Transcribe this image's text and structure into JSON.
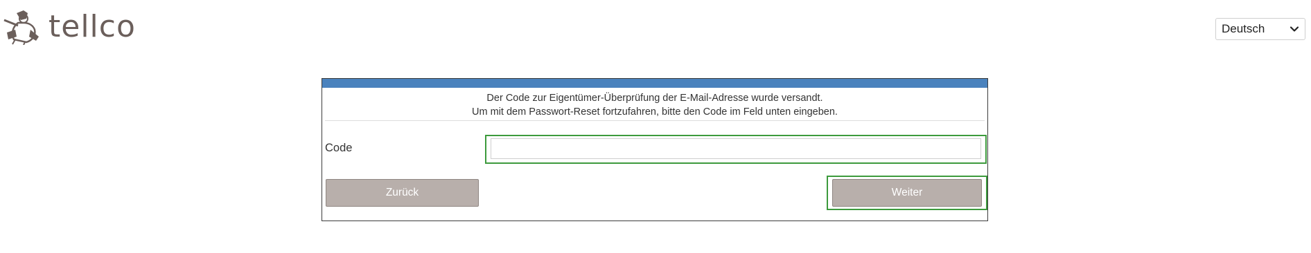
{
  "header": {
    "logo_text": "tellco",
    "language": {
      "selected": "Deutsch",
      "options": [
        "Deutsch"
      ]
    }
  },
  "form": {
    "intro_line1": "Der Code zur Eigentümer-Überprüfung der E-Mail-Adresse wurde versandt.",
    "intro_line2": "Um mit dem Passwort-Reset fortzufahren, bitte den Code im Feld unten eingeben.",
    "code_label": "Code",
    "code_value": "",
    "back_label": "Zurück",
    "next_label": "Weiter"
  },
  "colors": {
    "header_bar": "#4a82bd",
    "button": "#b8afab",
    "focus_outline": "#3c9a3c",
    "logo": "#6b5f5b"
  },
  "icons": {
    "logo_mascot": "mascot-icon",
    "dropdown": "chevron-down-icon"
  }
}
